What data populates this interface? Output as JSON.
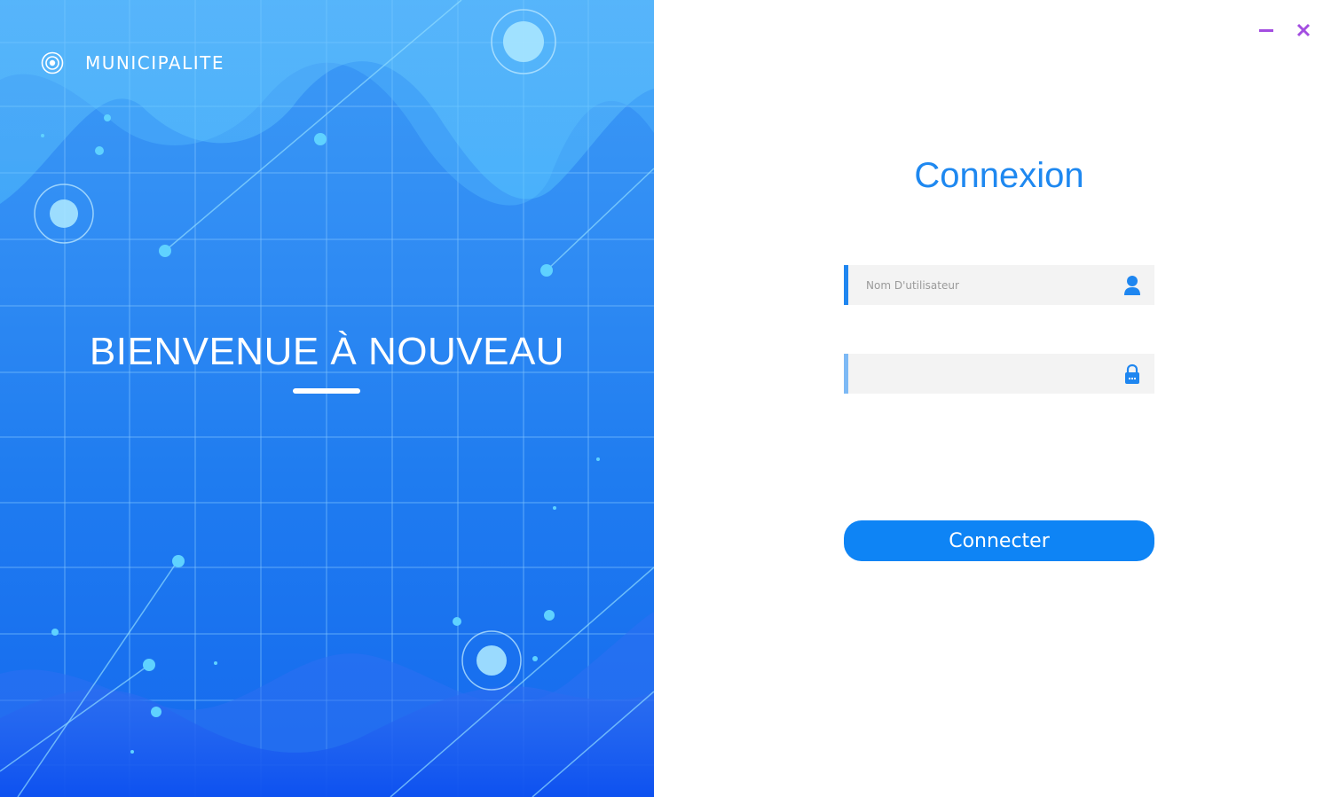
{
  "hero": {
    "brand": "MUNICIPALITE",
    "welcome": "BIENVENUE À NOUVEAU"
  },
  "window_controls": {
    "minimize_icon": "minimize-icon",
    "close_icon": "close-icon",
    "accent_color": "#a34ee0"
  },
  "login": {
    "title": "Connexion",
    "username": {
      "placeholder": "Nom D'utilisateur",
      "value": "",
      "icon": "user-icon"
    },
    "password": {
      "placeholder": "",
      "value": "",
      "icon": "lock-icon"
    },
    "submit_label": "Connecter"
  },
  "colors": {
    "primary": "#0e84f5",
    "title": "#1e88f0",
    "hero_top": "#3d9bf6",
    "hero_bottom": "#1468ee"
  }
}
